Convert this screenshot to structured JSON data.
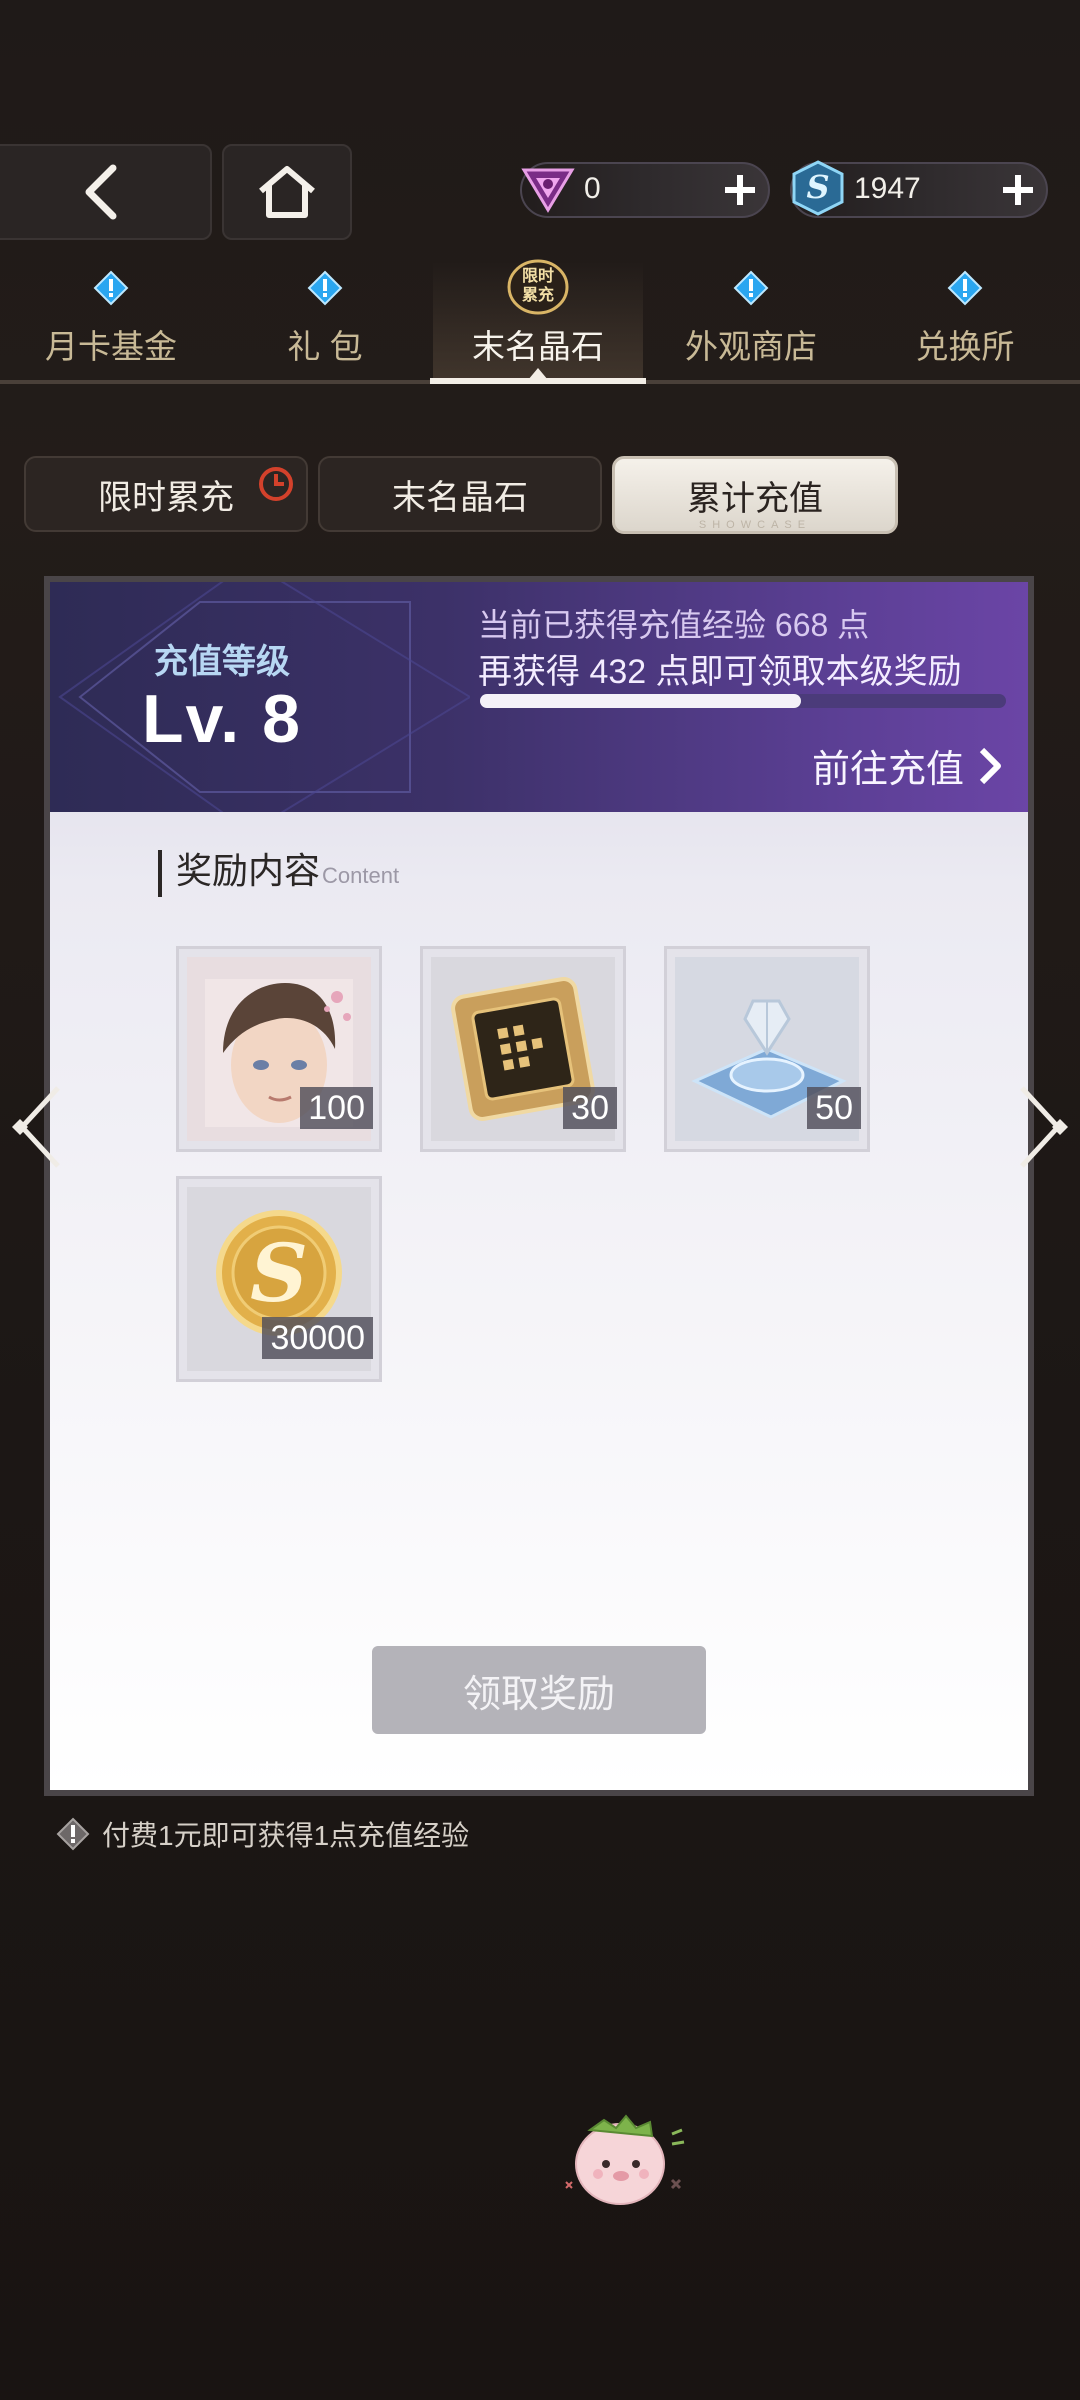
{
  "header": {
    "currencies": [
      {
        "icon": "gem-icon",
        "value": "0"
      },
      {
        "icon": "s-coin-icon",
        "value": "1947"
      }
    ]
  },
  "nav": {
    "tabs": [
      {
        "label": "月卡基金",
        "badge": "alert"
      },
      {
        "label": "礼 包",
        "badge": "alert"
      },
      {
        "label": "末名晶石",
        "badge": "限时累充",
        "active": true
      },
      {
        "label": "外观商店",
        "badge": "alert"
      },
      {
        "label": "兑换所",
        "badge": "alert"
      }
    ],
    "active_badge_line1": "限时",
    "active_badge_line2": "累充"
  },
  "subtabs": {
    "items": [
      {
        "label": "限时累充"
      },
      {
        "label": "末名晶石"
      },
      {
        "label": "累计充值",
        "selected": true
      }
    ],
    "watermark": "SHOWCASE"
  },
  "card": {
    "level_title": "充值等级",
    "level_value": "Lv. 8",
    "exp_line1": "当前已获得充值经验 668 点",
    "exp_line2": "再获得 432 点即可领取本级奖励",
    "progress": 0.61,
    "goto_label": "前往充值",
    "reward_title": "奖励内容",
    "reward_subtitle": "Content",
    "rewards": [
      {
        "icon": "character-portrait-icon",
        "qty": "100"
      },
      {
        "icon": "golden-chip-icon",
        "qty": "30"
      },
      {
        "icon": "crystal-platform-icon",
        "qty": "50"
      },
      {
        "icon": "s-coin-icon",
        "qty": "30000"
      }
    ],
    "claim_label": "领取奖励"
  },
  "note": "付费1元即可获得1点充值经验",
  "colors": {
    "accent_purple": "#5b3f94",
    "gold": "#c8b996"
  }
}
